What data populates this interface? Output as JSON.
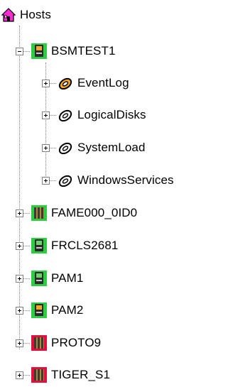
{
  "tree": {
    "root": {
      "label": "Hosts",
      "icon": "home-icon"
    },
    "hosts": [
      {
        "label": "BSMTEST1",
        "icon": "server-icon",
        "status_color": "#2ecc40",
        "expanded": true,
        "children": [
          {
            "label": "EventLog",
            "icon": "monitor-ring-icon",
            "status_color": "#f5a623"
          },
          {
            "label": "LogicalDisks",
            "icon": "monitor-ring-icon",
            "status_color": "#ffffff"
          },
          {
            "label": "SystemLoad",
            "icon": "monitor-ring-icon",
            "status_color": "#ffffff"
          },
          {
            "label": "WindowsServices",
            "icon": "monitor-ring-icon",
            "status_color": "#ffffff"
          }
        ]
      },
      {
        "label": "FAME000_0ID0",
        "icon": "cluster-icon",
        "status_color": "#2ecc40",
        "expanded": false
      },
      {
        "label": "FRCLS2681",
        "icon": "server-icon",
        "status_color": "#2ecc40",
        "expanded": false
      },
      {
        "label": "PAM1",
        "icon": "server-icon",
        "status_color": "#2ecc40",
        "expanded": false
      },
      {
        "label": "PAM2",
        "icon": "server-icon",
        "status_color": "#2ecc40",
        "expanded": false
      },
      {
        "label": "PROTO9",
        "icon": "cluster-icon",
        "status_color": "#e0103a",
        "expanded": false
      },
      {
        "label": "TIGER_S1",
        "icon": "cluster-icon",
        "status_color": "#e0103a",
        "expanded": false
      }
    ]
  }
}
